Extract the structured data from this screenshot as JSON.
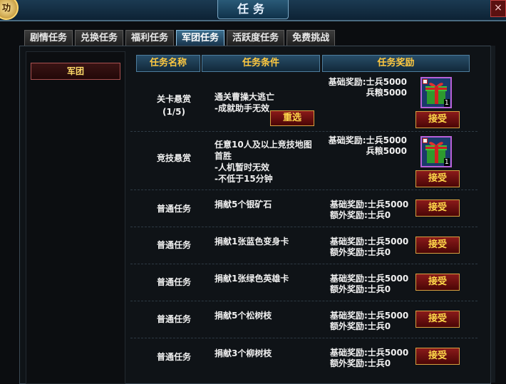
{
  "window": {
    "title": "任务",
    "badge": "功",
    "close": "×"
  },
  "tabs": [
    {
      "label": "剧情任务",
      "active": false
    },
    {
      "label": "兑换任务",
      "active": false
    },
    {
      "label": "福利任务",
      "active": false
    },
    {
      "label": "军团任务",
      "active": true
    },
    {
      "label": "活跃度任务",
      "active": false
    },
    {
      "label": "免费挑战",
      "active": false
    }
  ],
  "sidebar": {
    "items": [
      {
        "label": "军团"
      }
    ]
  },
  "table": {
    "headers": [
      "任务名称",
      "任务条件",
      "任务奖励"
    ],
    "rows": [
      {
        "name": "关卡悬赏\n(1/5)",
        "condition": "通关曹操大逃亡\n-成就助手无效",
        "reward_line1": "基础奖励:士兵5000",
        "reward_line2": "兵粮5000",
        "has_gift": true,
        "gift_qty": "1",
        "accept": "接受",
        "reselect": "重选"
      },
      {
        "name": "竞技悬赏",
        "condition": "任意10人及以上竞技地图首胜\n-人机暂时无效\n-不低于15分钟",
        "reward_line1": "基础奖励:士兵5000",
        "reward_line2": "兵粮5000",
        "has_gift": true,
        "gift_qty": "1",
        "accept": "接受"
      },
      {
        "name": "普通任务",
        "condition": "捐献5个银矿石",
        "reward_line1": "基础奖励:士兵5000",
        "reward_line2": "额外奖励:士兵0",
        "has_gift": false,
        "accept": "接受"
      },
      {
        "name": "普通任务",
        "condition": "捐献1张蓝色变身卡",
        "reward_line1": "基础奖励:士兵5000",
        "reward_line2": "额外奖励:士兵0",
        "has_gift": false,
        "accept": "接受"
      },
      {
        "name": "普通任务",
        "condition": "捐献1张绿色英雄卡",
        "reward_line1": "基础奖励:士兵5000",
        "reward_line2": "额外奖励:士兵0",
        "has_gift": false,
        "accept": "接受"
      },
      {
        "name": "普通任务",
        "condition": "捐献5个松树枝",
        "reward_line1": "基础奖励:士兵5000",
        "reward_line2": "额外奖励:士兵0",
        "has_gift": false,
        "accept": "接受"
      },
      {
        "name": "普通任务",
        "condition": "捐献3个柳树枝",
        "reward_line1": "基础奖励:士兵5000",
        "reward_line2": "额外奖励:士兵0",
        "has_gift": false,
        "accept": "接受"
      }
    ]
  },
  "icons": {
    "gift": "gift-box-icon",
    "close": "close-icon"
  },
  "colors": {
    "accent": "#ffc940",
    "button": "#8a1a1a",
    "button_text": "#ffd84a"
  }
}
